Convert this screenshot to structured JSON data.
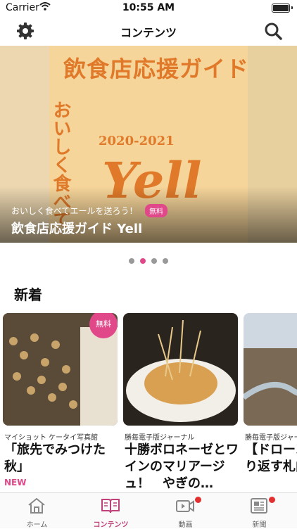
{
  "status_bar": {
    "carrier": "Carrier",
    "time": "10:55 AM"
  },
  "nav": {
    "title": "コンテンツ",
    "left_icon": "gear-icon",
    "right_icon": "search-icon"
  },
  "banner": {
    "heading": "飲食店応援ガイド",
    "years": "2020-2021",
    "logo_word": "Yell",
    "vertical_text": "おいしく食べて",
    "subtitle": "おいしく食べてエールを送ろう！",
    "free_label": "無料",
    "title": "飲食店応援ガイド Yell"
  },
  "carousel": {
    "total": 4,
    "active_index": 1
  },
  "section": {
    "title": "新着"
  },
  "cards": [
    {
      "source": "マイショット ケータイ写真館",
      "title": "「旅先でみつけた秋」",
      "badge": "無料",
      "new_label": "NEW"
    },
    {
      "source": "勝毎電子版ジャーナル",
      "title": "十勝ボロネーゼとワインのマリアージュ！　やぎの…"
    },
    {
      "source": "勝毎電子版ジャーナル",
      "title": "【ドローン】蛇行繰り返す札内川"
    }
  ],
  "tabs": [
    {
      "label": "ホーム",
      "icon": "home-icon",
      "active": false
    },
    {
      "label": "コンテンツ",
      "icon": "book-icon",
      "active": true
    },
    {
      "label": "動画",
      "icon": "video-icon",
      "active": false,
      "badge": true
    },
    {
      "label": "新聞",
      "icon": "newspaper-icon",
      "active": false,
      "badge": true
    }
  ],
  "colors": {
    "accent": "#e0488a",
    "banner_orange": "#e07a2a",
    "badge_red": "#e23030"
  }
}
